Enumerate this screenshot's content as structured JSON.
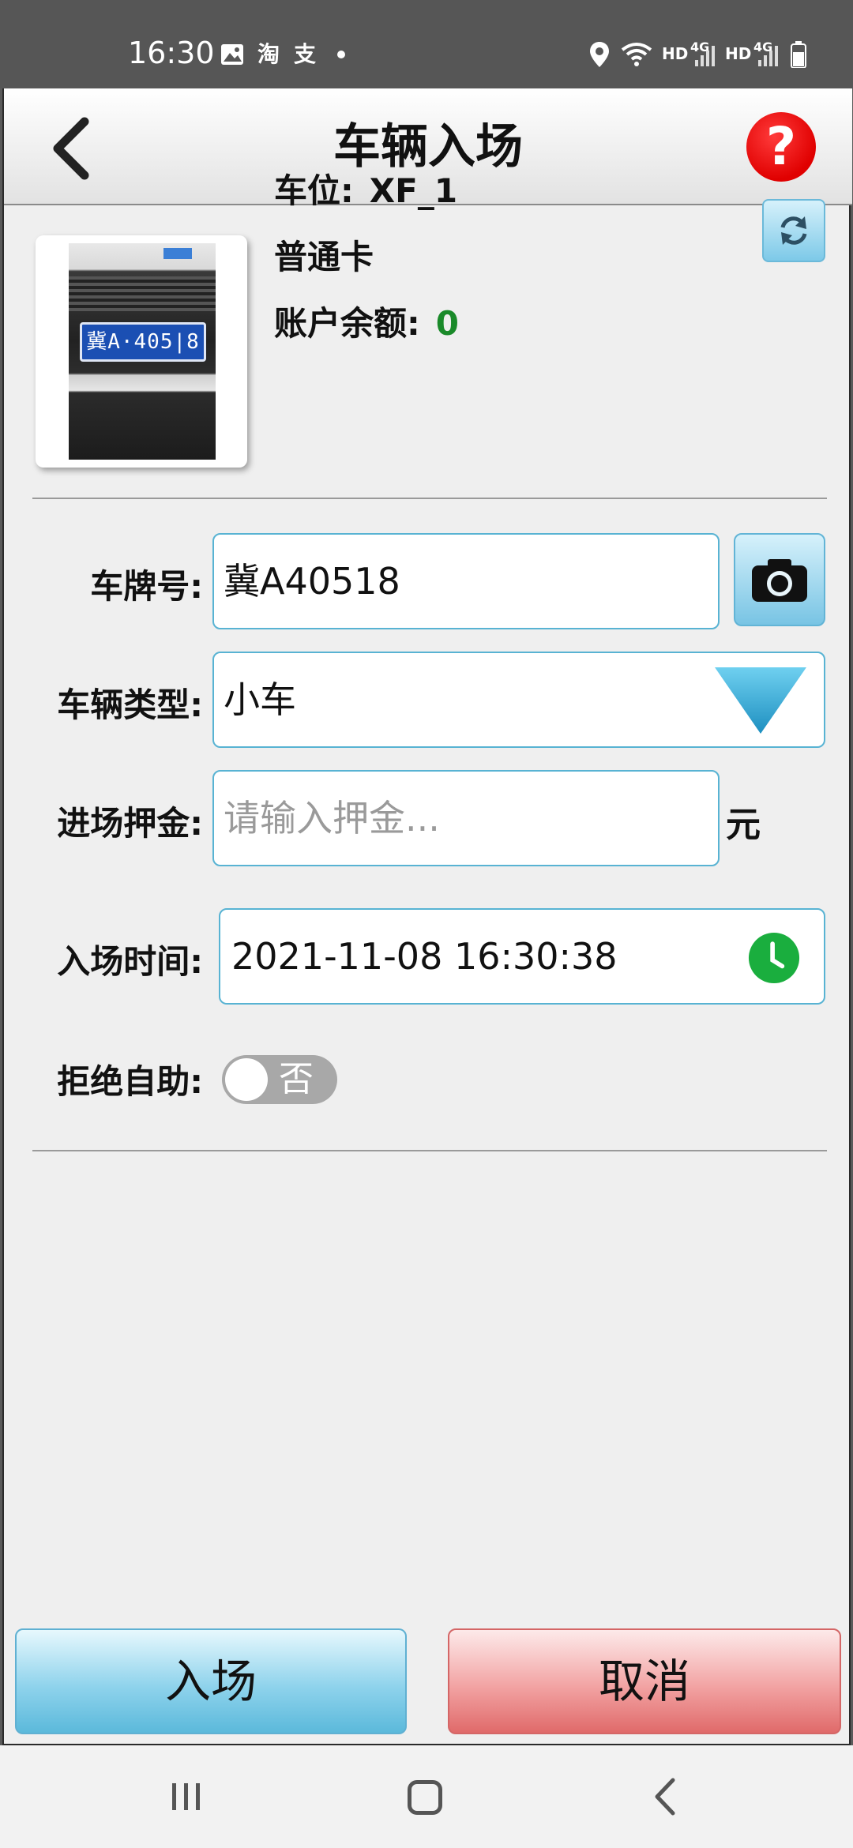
{
  "status_bar": {
    "time": "16:30",
    "icons": [
      "gallery-icon",
      "taobao-icon",
      "alipay-icon",
      "dot-icon",
      "location-icon",
      "wifi-icon",
      "hd-4g-signal-icon",
      "hd-4g-signal-icon",
      "battery-icon"
    ],
    "hd_label": "HD",
    "net_label": "4G"
  },
  "header": {
    "title": "车辆入场",
    "help_symbol": "?"
  },
  "vehicle_info": {
    "plate_photo_text": "冀A·405|8",
    "space_label": "车位:",
    "space_value": "XF_1",
    "card_type": "普通卡",
    "balance_label": "账户余额:",
    "balance_value": "0"
  },
  "form": {
    "plate_label": "车牌号:",
    "plate_value": "冀A40518",
    "vehicle_type_label": "车辆类型:",
    "vehicle_type_value": "小车",
    "deposit_label": "进场押金:",
    "deposit_placeholder": "请输入押金...",
    "deposit_unit": "元",
    "entry_time_label": "入场时间:",
    "entry_time_value": "2021-11-08 16:30:38",
    "refuse_self_service_label": "拒绝自助:",
    "refuse_self_service_value": "否"
  },
  "actions": {
    "enter_label": "入场",
    "cancel_label": "取消"
  },
  "colors": {
    "accent_blue": "#58b3d3",
    "balance_green": "#1a8a2a",
    "help_red": "#e00000",
    "clock_green": "#1aae3e"
  }
}
